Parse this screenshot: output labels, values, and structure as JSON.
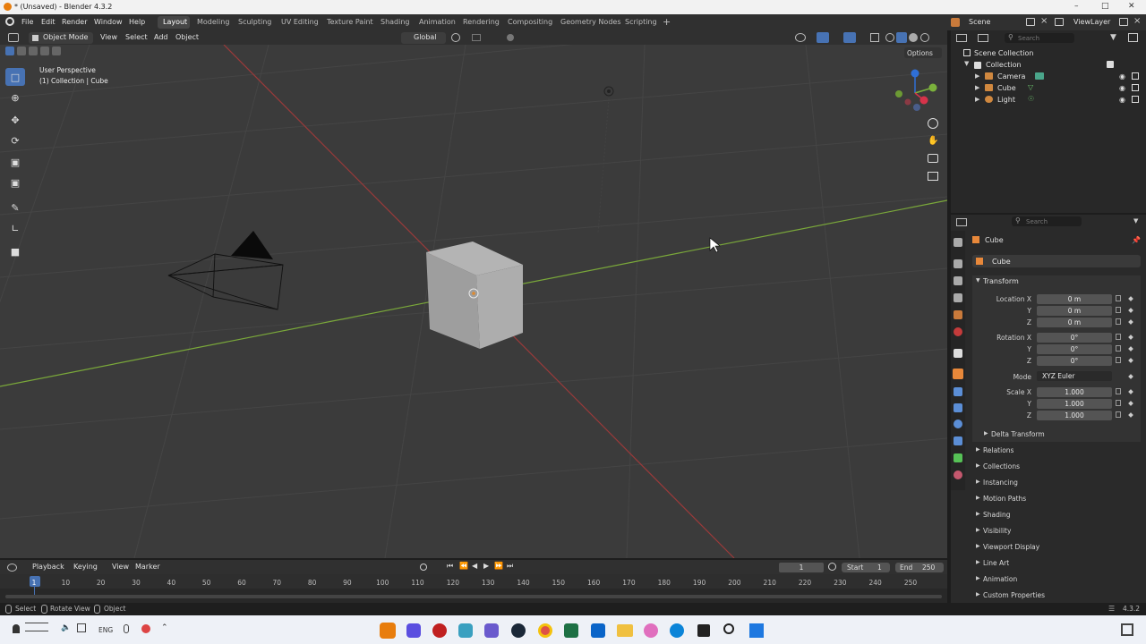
{
  "window": {
    "title": "* (Unsaved) - Blender 4.3.2"
  },
  "menu": {
    "items": [
      "File",
      "Edit",
      "Render",
      "Window",
      "Help"
    ]
  },
  "workspaces": {
    "tabs": [
      "Layout",
      "Modeling",
      "Sculpting",
      "UV Editing",
      "Texture Paint",
      "Shading",
      "Animation",
      "Rendering",
      "Compositing",
      "Geometry Nodes",
      "Scripting"
    ],
    "active": "Layout",
    "add_label": "+"
  },
  "scene": {
    "scene_label": "Scene",
    "viewlayer_label": "ViewLayer"
  },
  "viewport_header": {
    "mode": "Object Mode",
    "view": "View",
    "select": "Select",
    "add": "Add",
    "object": "Object",
    "orientation": "Global",
    "options": "Options"
  },
  "viewport": {
    "perspective": "User Perspective",
    "context": "(1) Collection | Cube"
  },
  "outliner": {
    "search_placeholder": "Search",
    "scene_collection": "Scene Collection",
    "collection": "Collection",
    "objects": [
      "Camera",
      "Cube",
      "Light"
    ]
  },
  "properties": {
    "search_placeholder": "Search",
    "object_name": "Cube",
    "datablock_name": "Cube",
    "transform_label": "Transform",
    "location_label": "Location X",
    "rotation_label": "Rotation X",
    "scale_label": "Scale X",
    "axis_y": "Y",
    "axis_z": "Z",
    "location": [
      "0 m",
      "0 m",
      "0 m"
    ],
    "rotation": [
      "0°",
      "0°",
      "0°"
    ],
    "mode_label": "Mode",
    "mode_value": "XYZ Euler",
    "scale": [
      "1.000",
      "1.000",
      "1.000"
    ],
    "delta_transform": "Delta Transform",
    "sections": [
      "Relations",
      "Collections",
      "Instancing",
      "Motion Paths",
      "Shading",
      "Visibility",
      "Viewport Display",
      "Line Art",
      "Animation",
      "Custom Properties"
    ]
  },
  "timeline": {
    "playback": "Playback",
    "keying": "Keying",
    "view": "View",
    "marker": "Marker",
    "current_frame": "1",
    "start_label": "Start",
    "start": "1",
    "end_label": "End",
    "end": "250",
    "ticks": [
      "1",
      "10",
      "20",
      "30",
      "40",
      "50",
      "60",
      "70",
      "80",
      "90",
      "100",
      "110",
      "120",
      "130",
      "140",
      "150",
      "160",
      "170",
      "180",
      "190",
      "200",
      "210",
      "220",
      "230",
      "240",
      "250"
    ]
  },
  "statusbar": {
    "select": "Select",
    "rotate": "Rotate View",
    "object": "Object",
    "version": "4.3.2"
  },
  "taskbar": {
    "lang": "ENG"
  },
  "colors": {
    "accent": "#4772b3",
    "x_axis": "#9b3a3a",
    "y_axis": "#7aa83a",
    "viewport_bg": "#3b3b3b"
  }
}
